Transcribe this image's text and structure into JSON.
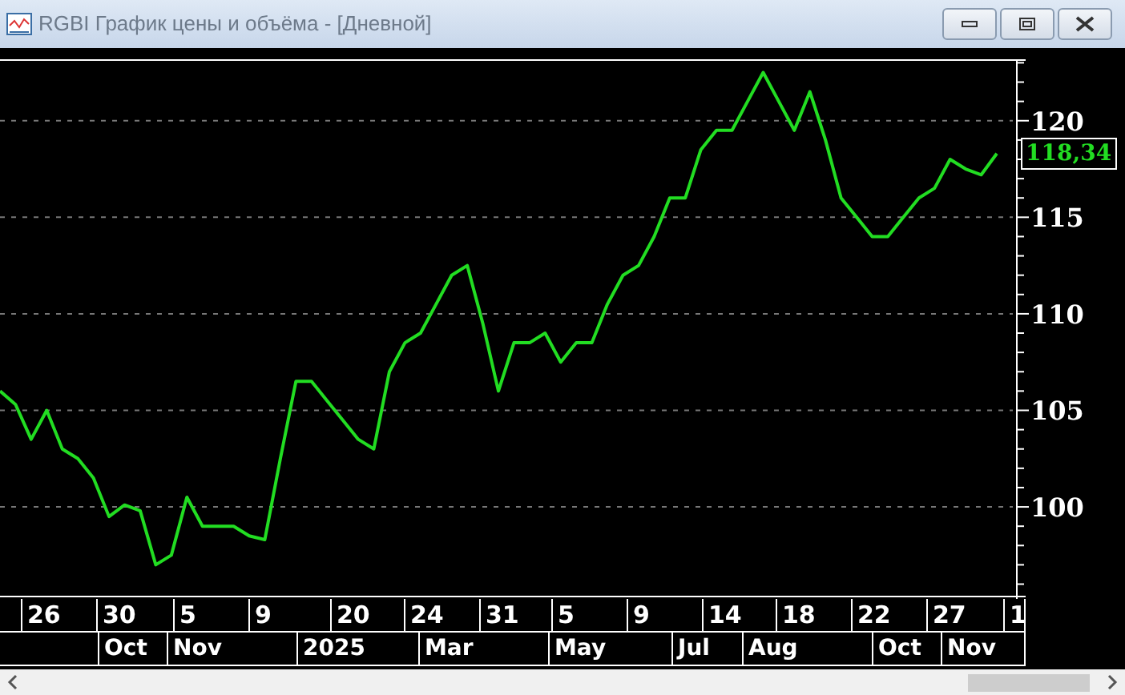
{
  "window": {
    "title": "RGBI График цены и объёма - [Дневной]"
  },
  "chart_data": {
    "type": "line",
    "grid": true,
    "ylim": [
      95.4,
      123.1
    ],
    "yticks": [
      100,
      105,
      110,
      115,
      120
    ],
    "series": [
      {
        "color": "#22dd22",
        "values": [
          106,
          105.3,
          103.5,
          105,
          103,
          102.5,
          101.5,
          99.5,
          100.1,
          99.8,
          97,
          97.5,
          100.5,
          99,
          99,
          99,
          98.5,
          98.3,
          102.5,
          106.5,
          106.5,
          105.5,
          104.5,
          103.5,
          103,
          107,
          108.5,
          109,
          110.5,
          112,
          112.5,
          109.5,
          106,
          108.5,
          108.5,
          109,
          107.5,
          108.5,
          108.5,
          110.5,
          112,
          112.5,
          114,
          116,
          116,
          118.5,
          119.5,
          119.5,
          121,
          122.5,
          121,
          119.5,
          121.5,
          119,
          116,
          115,
          114,
          114,
          115,
          116,
          116.5,
          118,
          117.5,
          117.2,
          118.3
        ]
      }
    ]
  },
  "last_value": "118,34",
  "day_labels": [
    "26",
    "30",
    "5",
    "9",
    "20",
    "24",
    "31",
    "5",
    "9",
    "14",
    "18",
    "22",
    "27",
    "1"
  ],
  "month_labels": [
    "Oct",
    "Nov",
    "2025",
    "Mar",
    "May",
    "Jul",
    "Aug",
    "Oct",
    "Nov"
  ]
}
